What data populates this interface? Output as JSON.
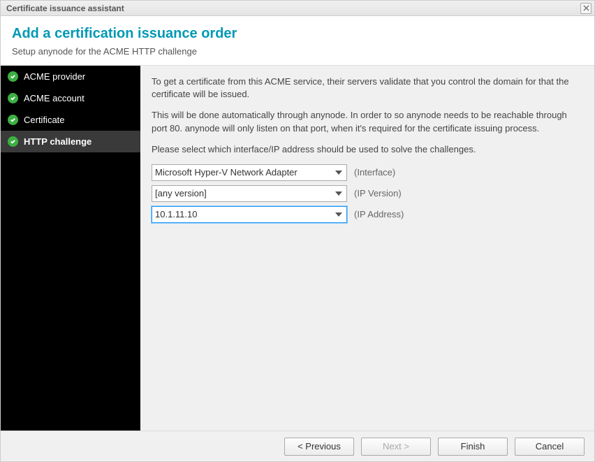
{
  "window": {
    "title": "Certificate issuance assistant"
  },
  "header": {
    "title": "Add a certification issuance order",
    "subtitle": "Setup anynode for the ACME HTTP challenge"
  },
  "sidebar": {
    "items": [
      {
        "label": "ACME provider"
      },
      {
        "label": "ACME account"
      },
      {
        "label": "Certificate"
      },
      {
        "label": "HTTP challenge"
      }
    ]
  },
  "content": {
    "para1": "To get a certificate from this ACME service, their servers validate that you control the domain for that the certificate will be issued.",
    "para2": "This will be done automatically through anynode. In order to so anynode needs to be reachable through port 80. anynode will only listen on that port, when it's required for the certificate issuing process.",
    "para3": "Please select which interface/IP address should be used to solve the challenges.",
    "interface": {
      "value": "Microsoft Hyper-V Network Adapter",
      "label": "(Interface)"
    },
    "ipversion": {
      "value": "[any version]",
      "label": "(IP Version)"
    },
    "ipaddress": {
      "value": "10.1.11.10",
      "label": "(IP Address)"
    }
  },
  "footer": {
    "previous": "< Previous",
    "next": "Next >",
    "finish": "Finish",
    "cancel": "Cancel"
  }
}
